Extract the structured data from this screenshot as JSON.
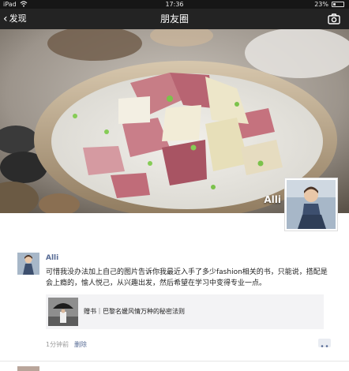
{
  "status_bar": {
    "carrier": "iPad",
    "time": "17:36",
    "battery": "23%"
  },
  "nav": {
    "back_label": "发现",
    "title": "朋友圈",
    "camera_icon": "camera-icon"
  },
  "cover": {
    "user_name": "Alli"
  },
  "feed": [
    {
      "name": "Alli",
      "text": "可惜我没办法加上自己的图片告诉你我最近入手了多少fashion相关的书，只能说，搭配是会上瘾的，愉人悦己，从兴趣出发，然后希望在学习中变得专业一点。",
      "link_title": "赠书｜巴黎名媛风情万种的秘密法则",
      "time": "1分钟前",
      "delete_label": "删除"
    }
  ],
  "colors": {
    "link_blue": "#576b95",
    "nav_bg": "#232323"
  }
}
